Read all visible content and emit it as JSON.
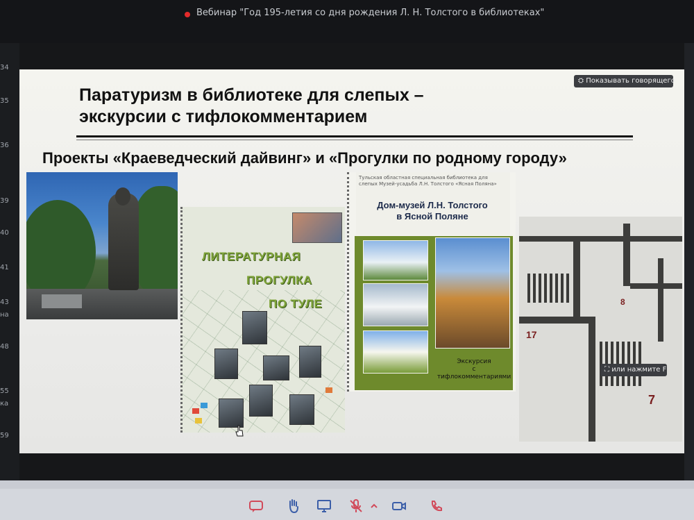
{
  "meeting": {
    "title": "Вебинар \"Год 195-летия со дня рождения Л. Н. Толстого в библиотеках\""
  },
  "left_strip": {
    "numbers": [
      "34",
      "35",
      "36",
      "39",
      "40",
      "41",
      "43",
      "48",
      "55",
      "59"
    ],
    "labels": [
      "на",
      "ка"
    ]
  },
  "slide": {
    "title_line1": "Паратуризм в библиотеке для слепых –",
    "title_line2": "экскурсии с тифлокомментарием",
    "subtitle": "Проекты «Краеведческий дайвинг» и «Прогулки по родному городу»",
    "booklet": {
      "line1": "ЛИТЕРАТУРНАЯ",
      "line2": "ПРОГУЛКА",
      "line3": "ПО ТУЛЕ"
    },
    "brochure": {
      "small_text": "Тульская областная специальная библиотека для слепых Музей-усадьба Л.Н. Толстого «Ясная Поляна»",
      "title_line1": "Дом-музей Л.Н. Толстого",
      "title_line2": "в Ясной Поляне",
      "caption_line1": "Экскурсия",
      "caption_line2": "с тифлокомментариями"
    },
    "tactile_numbers": [
      "17",
      "8",
      "7"
    ]
  },
  "controls": {
    "show_speaker": "Показывать говорящего",
    "press_hint": "или нажмите F"
  },
  "toolbar": {
    "items": [
      "chat",
      "raise-hand",
      "screen-share",
      "microphone-muted",
      "options",
      "camera",
      "hang-up"
    ]
  }
}
